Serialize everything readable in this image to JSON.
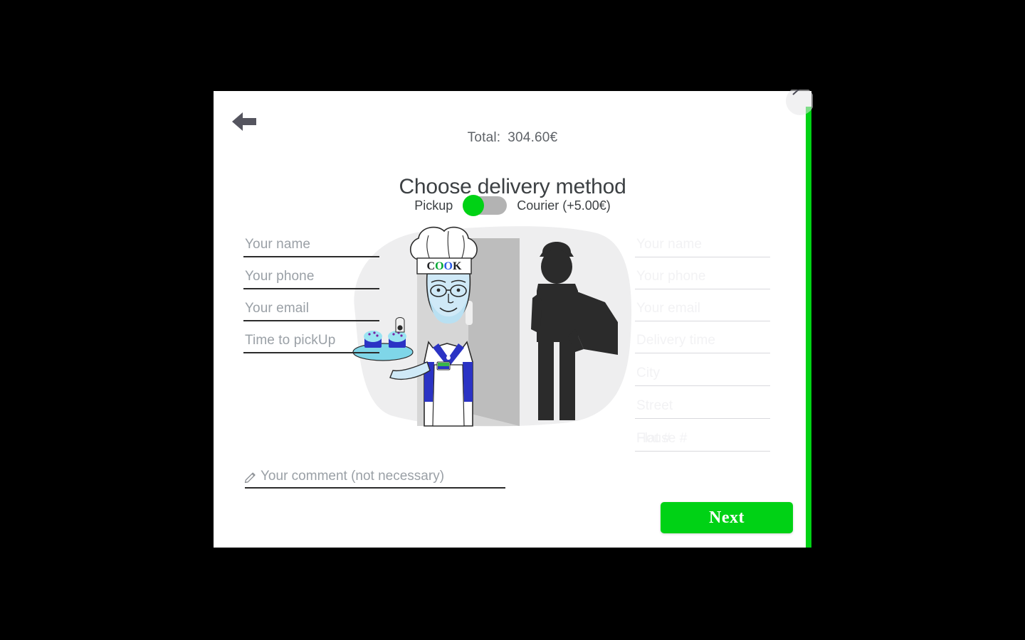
{
  "header": {
    "back_icon": "arrow-left-icon",
    "total_label": "Total:",
    "total_value": "304.60€",
    "title": "Choose delivery method"
  },
  "delivery_toggle": {
    "left_option": "Pickup",
    "right_option": "Courier (+5.00€)",
    "selected": "Pickup",
    "knob_color": "#00d215",
    "track_color": "#b3b3b3"
  },
  "pickup_form": {
    "fields": [
      {
        "name": "your-name",
        "placeholder": "Your name",
        "value": ""
      },
      {
        "name": "your-phone",
        "placeholder": "Your phone",
        "value": ""
      },
      {
        "name": "your-email",
        "placeholder": "Your email",
        "value": ""
      },
      {
        "name": "pickup-time",
        "placeholder": "Time to pickUp",
        "value": ""
      }
    ]
  },
  "courier_form": {
    "disabled": true,
    "fields": [
      {
        "name": "your-name",
        "placeholder": "Your name",
        "value": ""
      },
      {
        "name": "your-phone",
        "placeholder": "Your phone",
        "value": ""
      },
      {
        "name": "your-email",
        "placeholder": "Your email",
        "value": ""
      },
      {
        "name": "delivery-time",
        "placeholder": "Delivery time",
        "value": ""
      },
      {
        "name": "city",
        "placeholder": "City",
        "value": ""
      },
      {
        "name": "street",
        "placeholder": "Street",
        "value": ""
      },
      {
        "name": "house-number",
        "placeholder": "House #",
        "value": ""
      },
      {
        "name": "flat-number",
        "placeholder": "Flat #",
        "value": ""
      }
    ]
  },
  "comment": {
    "icon": "pencil-icon",
    "placeholder": "Your comment (not necessary)",
    "value": ""
  },
  "next_button": {
    "label": "Next",
    "color": "#00d215"
  },
  "illustration": {
    "chef_hat_text": "COOK",
    "hat_text_colors": [
      "#202124",
      "#00a832",
      "#2b5ce6",
      "#202124"
    ],
    "alt": "chef with cupcake tray at door and courier silhouette with package"
  },
  "scrollbar": {
    "color": "#00d215",
    "position": "right"
  },
  "theme": {
    "accent": "#00d215",
    "text": "#3c4043",
    "placeholder": "#9aa0a6"
  }
}
